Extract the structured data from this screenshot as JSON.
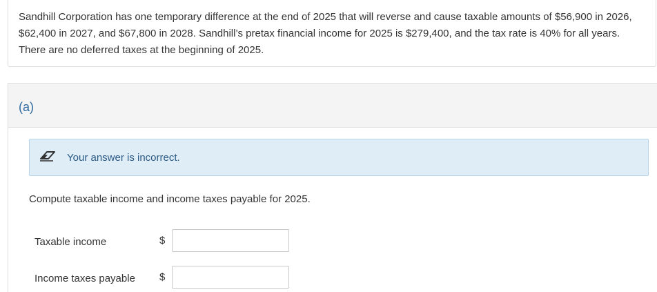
{
  "problem": {
    "text": "Sandhill Corporation has one temporary difference at the end of 2025 that will reverse and cause taxable amounts of $56,900 in 2026, $62,400 in 2027, and $67,800 in 2028. Sandhill’s pretax financial income for 2025 is $279,400, and the tax rate is 40% for all years. There are no deferred taxes at the beginning of 2025."
  },
  "part": {
    "label": "(a)",
    "feedback": {
      "icon": "eraser-icon",
      "text": "Your answer is incorrect.",
      "background_color": "#dfedf7"
    },
    "instruction": "Compute taxable income and income taxes payable for 2025.",
    "fields": [
      {
        "label": "Taxable income",
        "currency": "$",
        "value": ""
      },
      {
        "label": "Income taxes payable",
        "currency": "$",
        "value": ""
      }
    ]
  },
  "colors": {
    "accent": "#2d6a9f",
    "feedback_text": "#2b5a85"
  }
}
